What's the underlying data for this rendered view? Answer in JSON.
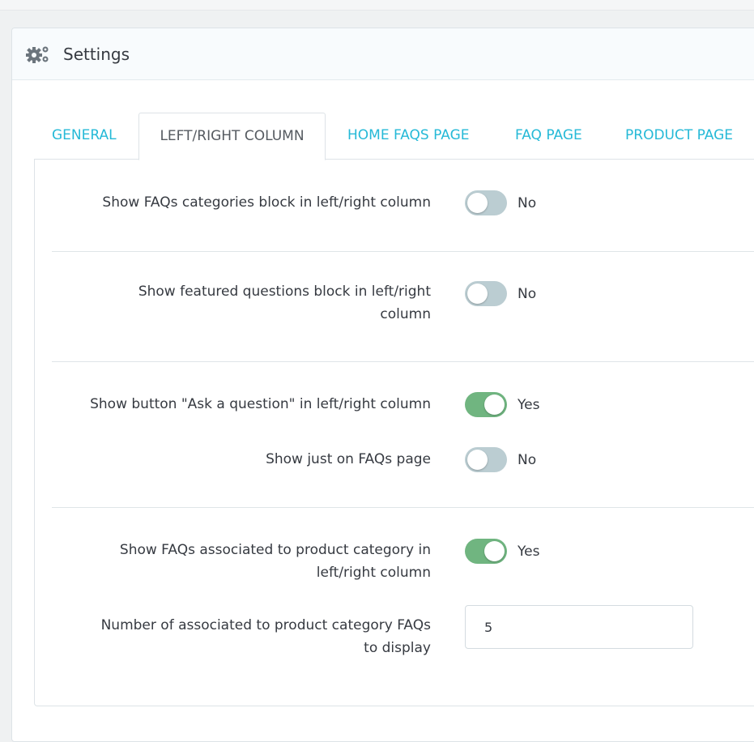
{
  "panel": {
    "title": "Settings",
    "icon": "gears-icon"
  },
  "tabs": [
    {
      "label": "GENERAL",
      "active": false
    },
    {
      "label": "LEFT/RIGHT COLUMN",
      "active": true
    },
    {
      "label": "HOME FAQS PAGE",
      "active": false
    },
    {
      "label": "FAQ PAGE",
      "active": false
    },
    {
      "label": "PRODUCT PAGE",
      "active": false
    }
  ],
  "settings": {
    "categories_block": {
      "label": "Show FAQs categories block in left/right column",
      "state": "No",
      "enabled": false
    },
    "featured_block": {
      "label_line1": "Show featured questions block in left/right",
      "label_line2": "column",
      "state": "No",
      "enabled": false
    },
    "ask_button": {
      "label": "Show button \"Ask a question\" in left/right column",
      "state": "Yes",
      "enabled": true
    },
    "just_faqs_page": {
      "label": "Show just on FAQs page",
      "state": "No",
      "enabled": false
    },
    "associated_faqs": {
      "label_line1": "Show FAQs associated to product category in",
      "label_line2": "left/right column",
      "state": "Yes",
      "enabled": true
    },
    "associated_count": {
      "label_line1": "Number of associated to product category FAQs",
      "label_line2": "to display",
      "value": "5"
    }
  },
  "colors": {
    "accent": "#25b9d7",
    "switch_on": "#70b580",
    "switch_off": "#bbcdd2"
  }
}
